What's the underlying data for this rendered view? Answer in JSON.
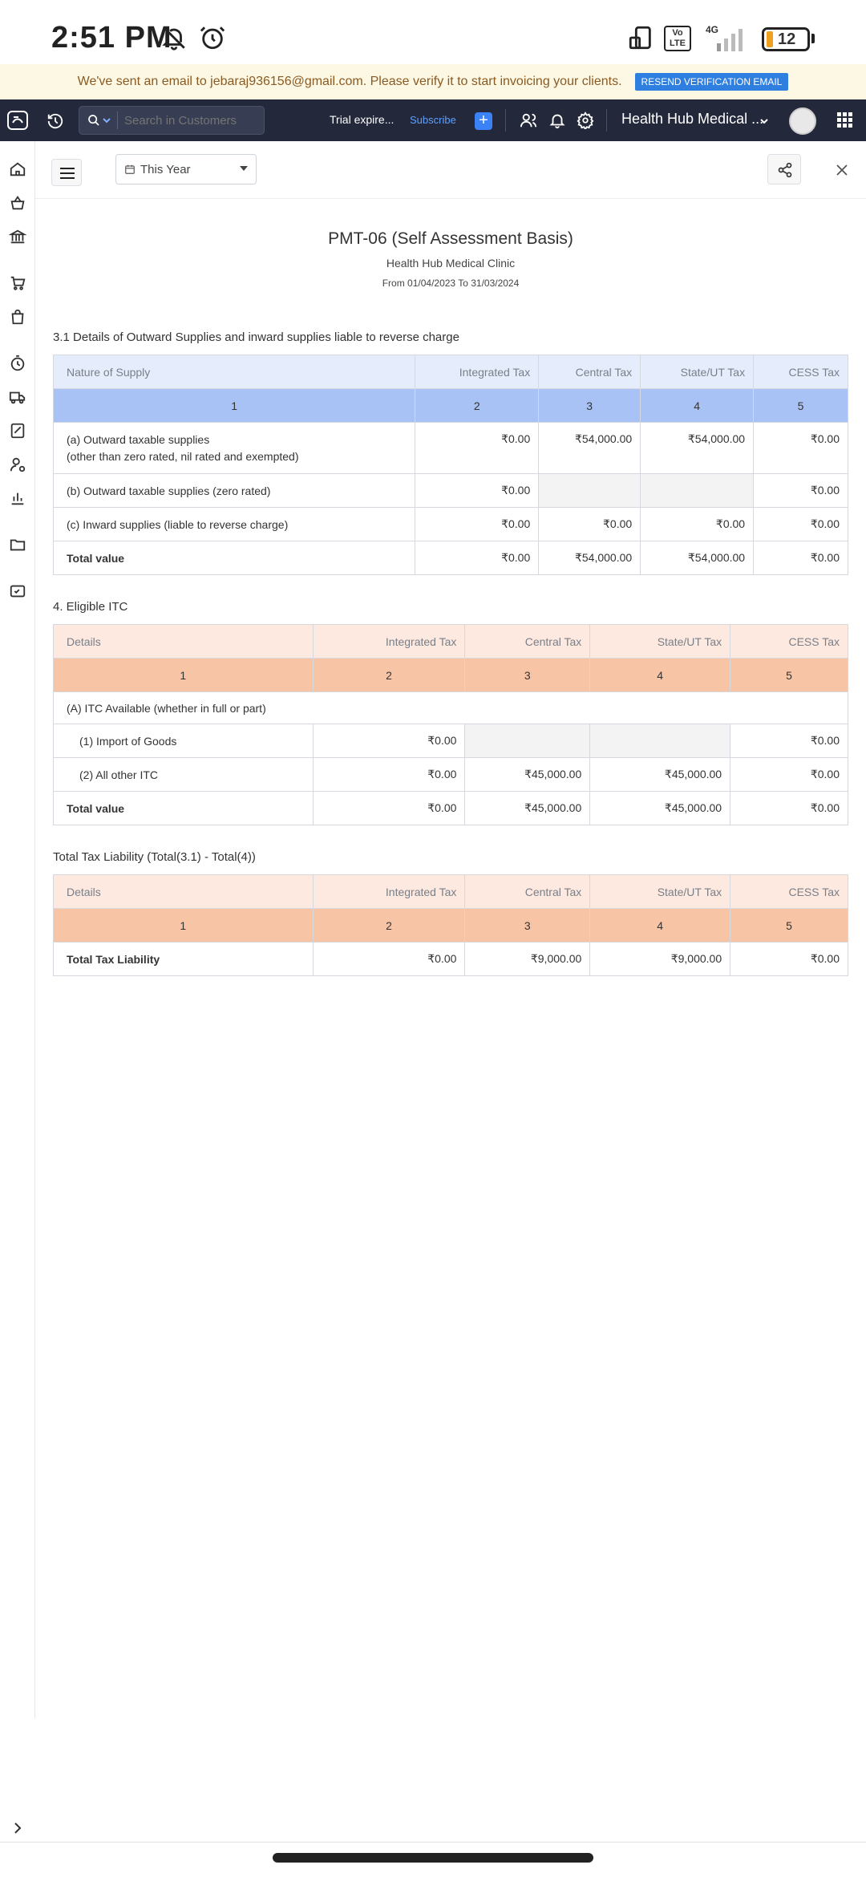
{
  "status_bar": {
    "time": "2:51 PM",
    "battery": "12",
    "network": "4G",
    "volte": "Vo LTE"
  },
  "banner": {
    "message": "We've sent an email to jebaraj936156@gmail.com. Please verify it to start invoicing your clients.",
    "resend_label": "RESEND VERIFICATION EMAIL"
  },
  "topbar": {
    "search_placeholder": "Search in Customers",
    "trial_text": "Trial expire...",
    "subscribe_label": "Subscribe",
    "org_name": "Health Hub Medical ..."
  },
  "toolbar": {
    "period": "This Year"
  },
  "report": {
    "title": "PMT-06 (Self Assessment Basis)",
    "org": "Health Hub Medical Clinic",
    "range": "From 01/04/2023 To 31/03/2024"
  },
  "section1": {
    "title": "3.1 Details of Outward Supplies and inward supplies liable to reverse charge",
    "headers": [
      "Nature of Supply",
      "Integrated Tax",
      "Central Tax",
      "State/UT Tax",
      "CESS Tax"
    ],
    "index": [
      "1",
      "2",
      "3",
      "4",
      "5"
    ],
    "rows": [
      {
        "label": "(a) Outward taxable supplies",
        "label2": "(other than zero rated, nil rated and exempted)",
        "igst": "₹0.00",
        "cgst": "₹54,000.00",
        "sgst": "₹54,000.00",
        "cess": "₹0.00"
      },
      {
        "label": "(b) Outward taxable supplies (zero rated)",
        "igst": "₹0.00",
        "cess": "₹0.00"
      },
      {
        "label": "(c) Inward supplies (liable to reverse charge)",
        "igst": "₹0.00",
        "cgst": "₹0.00",
        "sgst": "₹0.00",
        "cess": "₹0.00"
      },
      {
        "label": "Total value",
        "igst": "₹0.00",
        "cgst": "₹54,000.00",
        "sgst": "₹54,000.00",
        "cess": "₹0.00"
      }
    ]
  },
  "section2": {
    "title": "4. Eligible ITC",
    "headers": [
      "Details",
      "Integrated Tax",
      "Central Tax",
      "State/UT Tax",
      "CESS Tax"
    ],
    "index": [
      "1",
      "2",
      "3",
      "4",
      "5"
    ],
    "group_label": "(A) ITC Available (whether in full or part)",
    "rows": [
      {
        "label": "(1) Import of Goods",
        "igst": "₹0.00",
        "cess": "₹0.00"
      },
      {
        "label": "(2) All other ITC",
        "igst": "₹0.00",
        "cgst": "₹45,000.00",
        "sgst": "₹45,000.00",
        "cess": "₹0.00"
      },
      {
        "label": "Total value",
        "igst": "₹0.00",
        "cgst": "₹45,000.00",
        "sgst": "₹45,000.00",
        "cess": "₹0.00"
      }
    ]
  },
  "section3": {
    "title": "Total Tax Liability (Total(3.1) - Total(4))",
    "headers": [
      "Details",
      "Integrated Tax",
      "Central Tax",
      "State/UT Tax",
      "CESS Tax"
    ],
    "index": [
      "1",
      "2",
      "3",
      "4",
      "5"
    ],
    "row": {
      "label": "Total Tax Liability",
      "igst": "₹0.00",
      "cgst": "₹9,000.00",
      "sgst": "₹9,000.00",
      "cess": "₹0.00"
    }
  },
  "colors": {
    "topbar": "#23283b",
    "accent": "#2f7fe0",
    "blue_header": "#e5edfd",
    "blue_index": "#a8c2f5",
    "peach_header": "#fde9e0",
    "peach_index": "#f8c4a6"
  }
}
